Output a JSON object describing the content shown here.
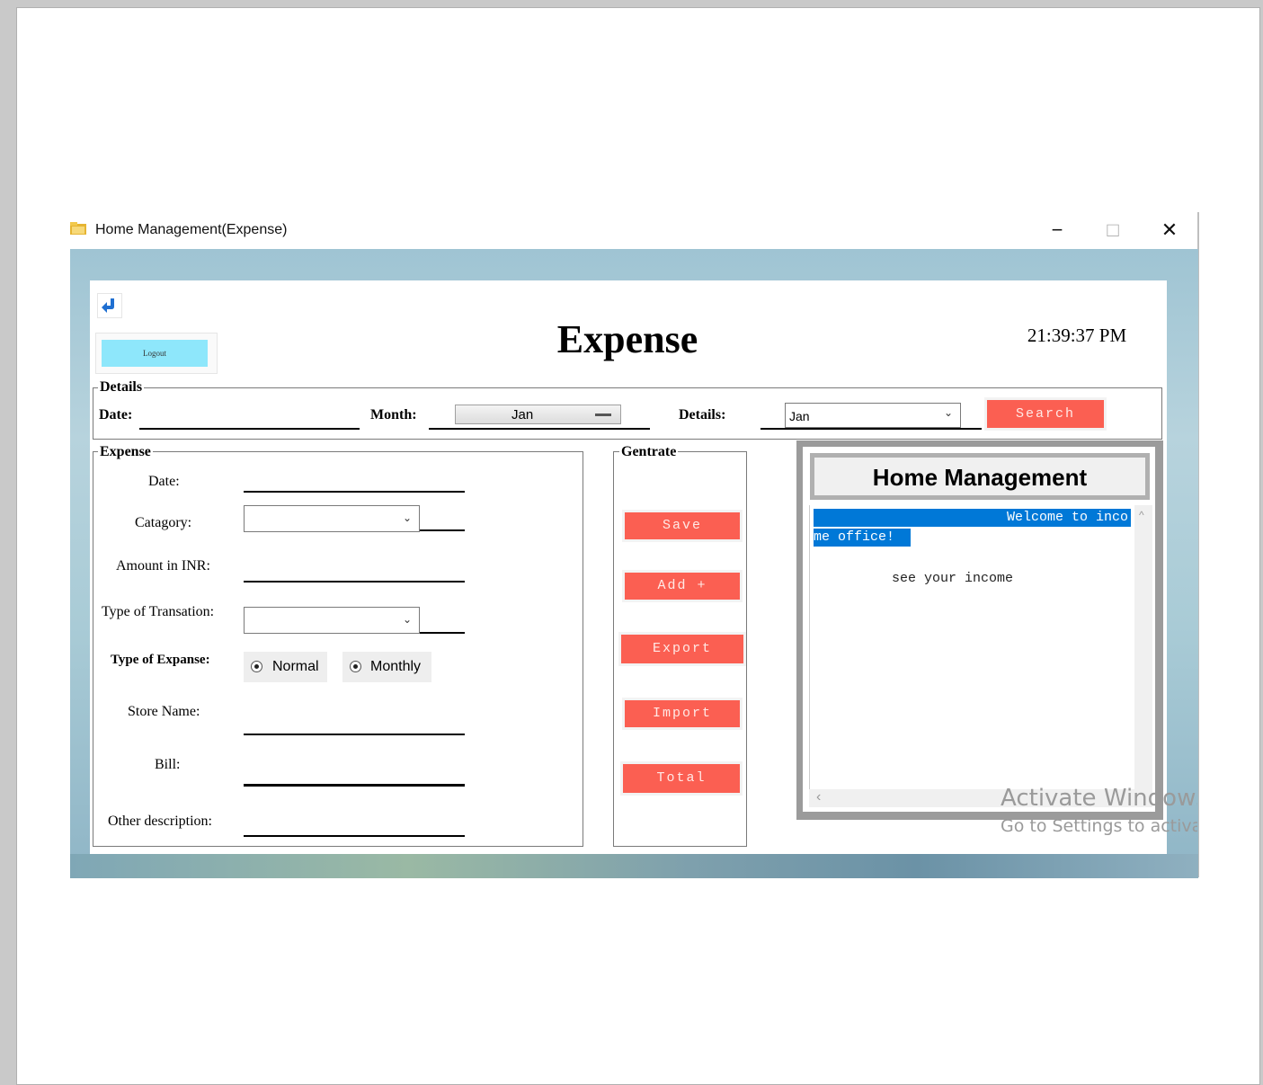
{
  "window": {
    "title": "Home Management(Expense)",
    "minimize": "−",
    "maximize": "□",
    "close": "✕"
  },
  "header": {
    "back_icon": "back-arrow-icon",
    "logout_label": "Logout",
    "page_title": "Expense",
    "clock": "21:39:37 PM"
  },
  "details": {
    "legend": "Details",
    "date_label": "Date:",
    "month_label": "Month:",
    "month_value": "Jan",
    "details_label": "Details:",
    "details_value": "Jan",
    "search_label": "Search"
  },
  "expense": {
    "legend": "Expense",
    "date_label": "Date:",
    "category_label": "Catagory:",
    "amount_label": "Amount in INR:",
    "transaction_label": "Type of Transation:",
    "expense_type_label": "Type of Expanse:",
    "radio_normal": "Normal",
    "radio_monthly": "Monthly",
    "store_label": "Store Name:",
    "bill_label": "Bill:",
    "other_label": "Other description:"
  },
  "generate": {
    "legend": "Gentrate",
    "save": "Save",
    "add": "Add +",
    "export": "Export",
    "import": "Import",
    "total": "Total"
  },
  "side_panel": {
    "title": "Home Management",
    "welcome_line1": "Welcome to inco",
    "welcome_line2": "me office!",
    "body_text": "see your income",
    "scroll_left": "‹",
    "scroll_up": "^"
  },
  "watermark": {
    "line1": "Activate Windows",
    "line2": "Go to Settings to activate"
  },
  "colors": {
    "accent_red": "#fb5f52",
    "logout_blue": "#8ee7fb",
    "selection_blue": "#0078d7"
  }
}
